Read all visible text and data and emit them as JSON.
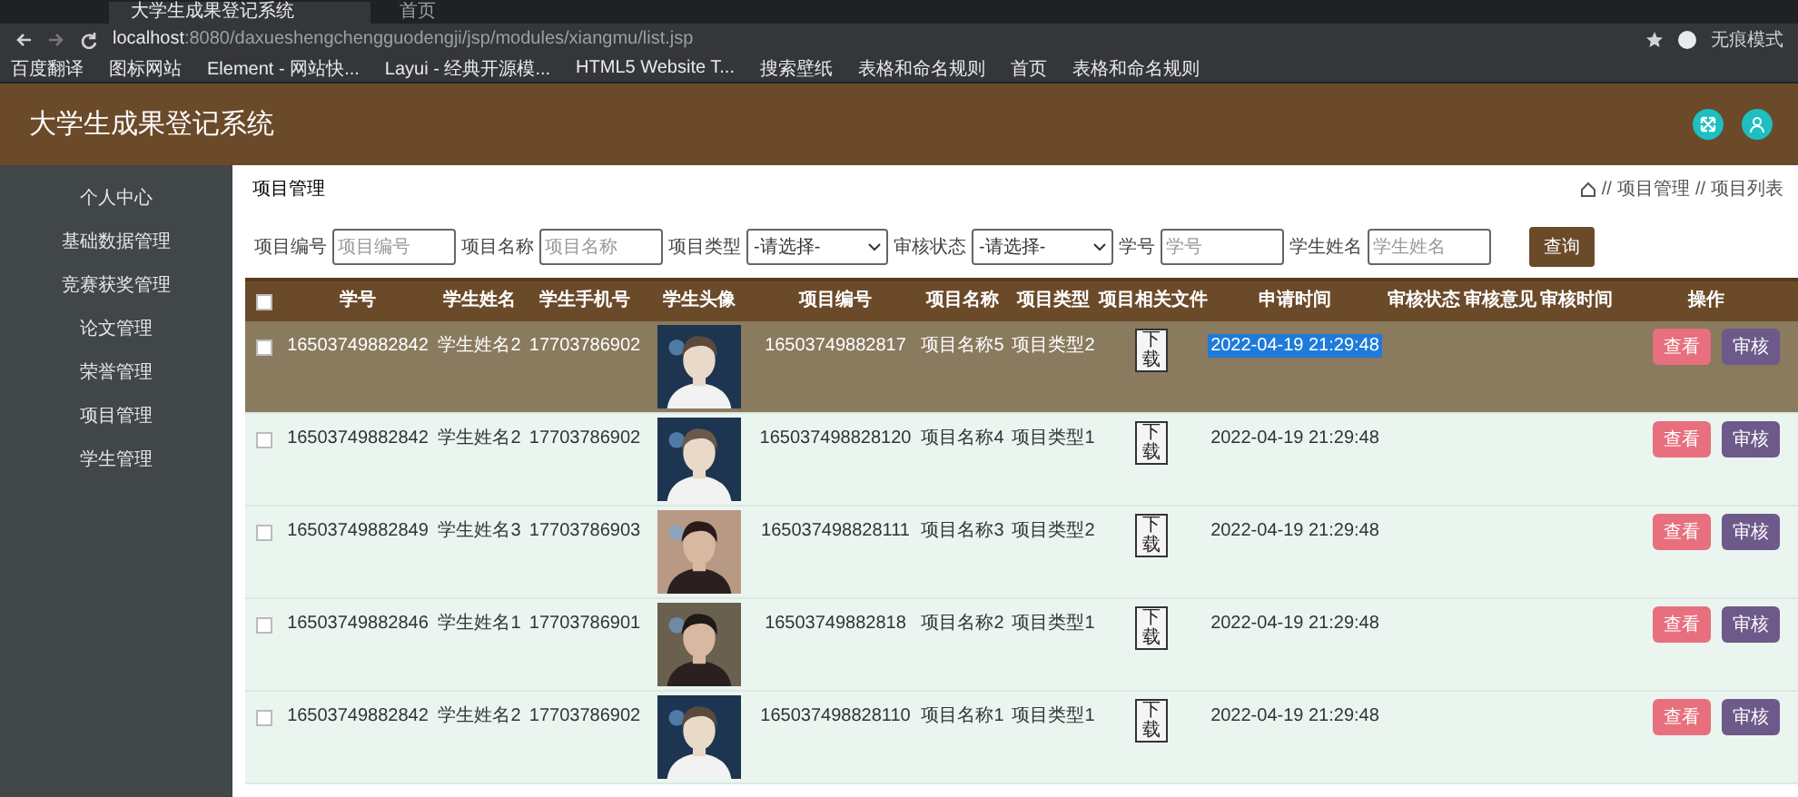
{
  "browser": {
    "tabs": [
      {
        "title": "大学生成果登记系统",
        "selected": true
      },
      {
        "title": "首页",
        "selected": false
      }
    ],
    "url_host": "localhost",
    "url_path": ":8080/daxueshengchengguodengji/jsp/modules/xiangmu/list.jsp",
    "profile": "无痕模式",
    "bookmarks": [
      "百度翻译",
      "图标网站",
      "Element - 网站快...",
      "Layui - 经典开源模...",
      "HTML5 Website T...",
      "搜索壁纸",
      "表格和命名规则",
      "首页",
      "表格和命名规则"
    ]
  },
  "app": {
    "title": "大学生成果登记系统"
  },
  "sidebar": {
    "items": [
      "个人中心",
      "基础数据管理",
      "竞赛获奖管理",
      "论文管理",
      "荣誉管理",
      "项目管理",
      "学生管理"
    ]
  },
  "page_title": "项目管理",
  "breadcrumb": [
    {
      "separator": "//",
      "label": "项目管理"
    },
    {
      "separator": "//",
      "label": "项目列表"
    }
  ],
  "filters": [
    {
      "kind": "input",
      "label": "项目编号",
      "placeholder": "项目编号"
    },
    {
      "kind": "input",
      "label": "项目名称",
      "placeholder": "项目名称"
    },
    {
      "kind": "select",
      "label": "项目类型",
      "value": "-请选择-"
    },
    {
      "kind": "select",
      "label": "审核状态",
      "value": "-请选择-"
    },
    {
      "kind": "input",
      "label": "学号",
      "placeholder": "学号"
    },
    {
      "kind": "input",
      "label": "学生姓名",
      "placeholder": "学生姓名"
    }
  ],
  "search_button": "查询",
  "table": {
    "all_checked": false,
    "columns": [
      "学号",
      "学生姓名",
      "学生手机号",
      "学生头像",
      "项目编号",
      "项目名称",
      "项目类型",
      "项目相关文件",
      "申请时间",
      "审核状态",
      "审核意见",
      "审核时间",
      "操作"
    ],
    "rows": [
      {
        "checked": false,
        "highlighted": true,
        "time_text_selected": true,
        "student_no": "16503749882842",
        "name": "学生姓名2",
        "phone": "17703786902",
        "project_no": "16503749882817",
        "project_name": "项目名称5",
        "project_type": "项目类型2",
        "file_button": "下载",
        "time": "2022-04-19 21:29:48",
        "actions": [
          "查看",
          "审核"
        ]
      },
      {
        "checked": false,
        "highlighted": false,
        "time_text_selected": false,
        "student_no": "16503749882842",
        "name": "学生姓名2",
        "phone": "17703786902",
        "project_no": "165037498828120",
        "project_name": "项目名称4",
        "project_type": "项目类型1",
        "file_button": "下载",
        "time": "2022-04-19 21:29:48",
        "actions": [
          "查看",
          "审核"
        ]
      },
      {
        "checked": false,
        "highlighted": false,
        "time_text_selected": false,
        "student_no": "16503749882849",
        "name": "学生姓名3",
        "phone": "17703786903",
        "project_no": "165037498828111",
        "project_name": "项目名称3",
        "project_type": "项目类型2",
        "file_button": "下载",
        "time": "2022-04-19 21:29:48",
        "actions": [
          "查看",
          "审核"
        ]
      },
      {
        "checked": false,
        "highlighted": false,
        "time_text_selected": false,
        "student_no": "16503749882846",
        "name": "学生姓名1",
        "phone": "17703786901",
        "project_no": "16503749882818",
        "project_name": "项目名称2",
        "project_type": "项目类型1",
        "file_button": "下载",
        "time": "2022-04-19 21:29:48",
        "actions": [
          "查看",
          "审核"
        ]
      },
      {
        "checked": false,
        "highlighted": false,
        "time_text_selected": false,
        "student_no": "16503749882842",
        "name": "学生姓名2",
        "phone": "17703786902",
        "project_no": "165037498828110",
        "project_name": "项目名称1",
        "project_type": "项目类型1",
        "file_button": "下载",
        "time": "2022-04-19 21:29:48",
        "actions": [
          "查看",
          "审核"
        ]
      }
    ]
  }
}
